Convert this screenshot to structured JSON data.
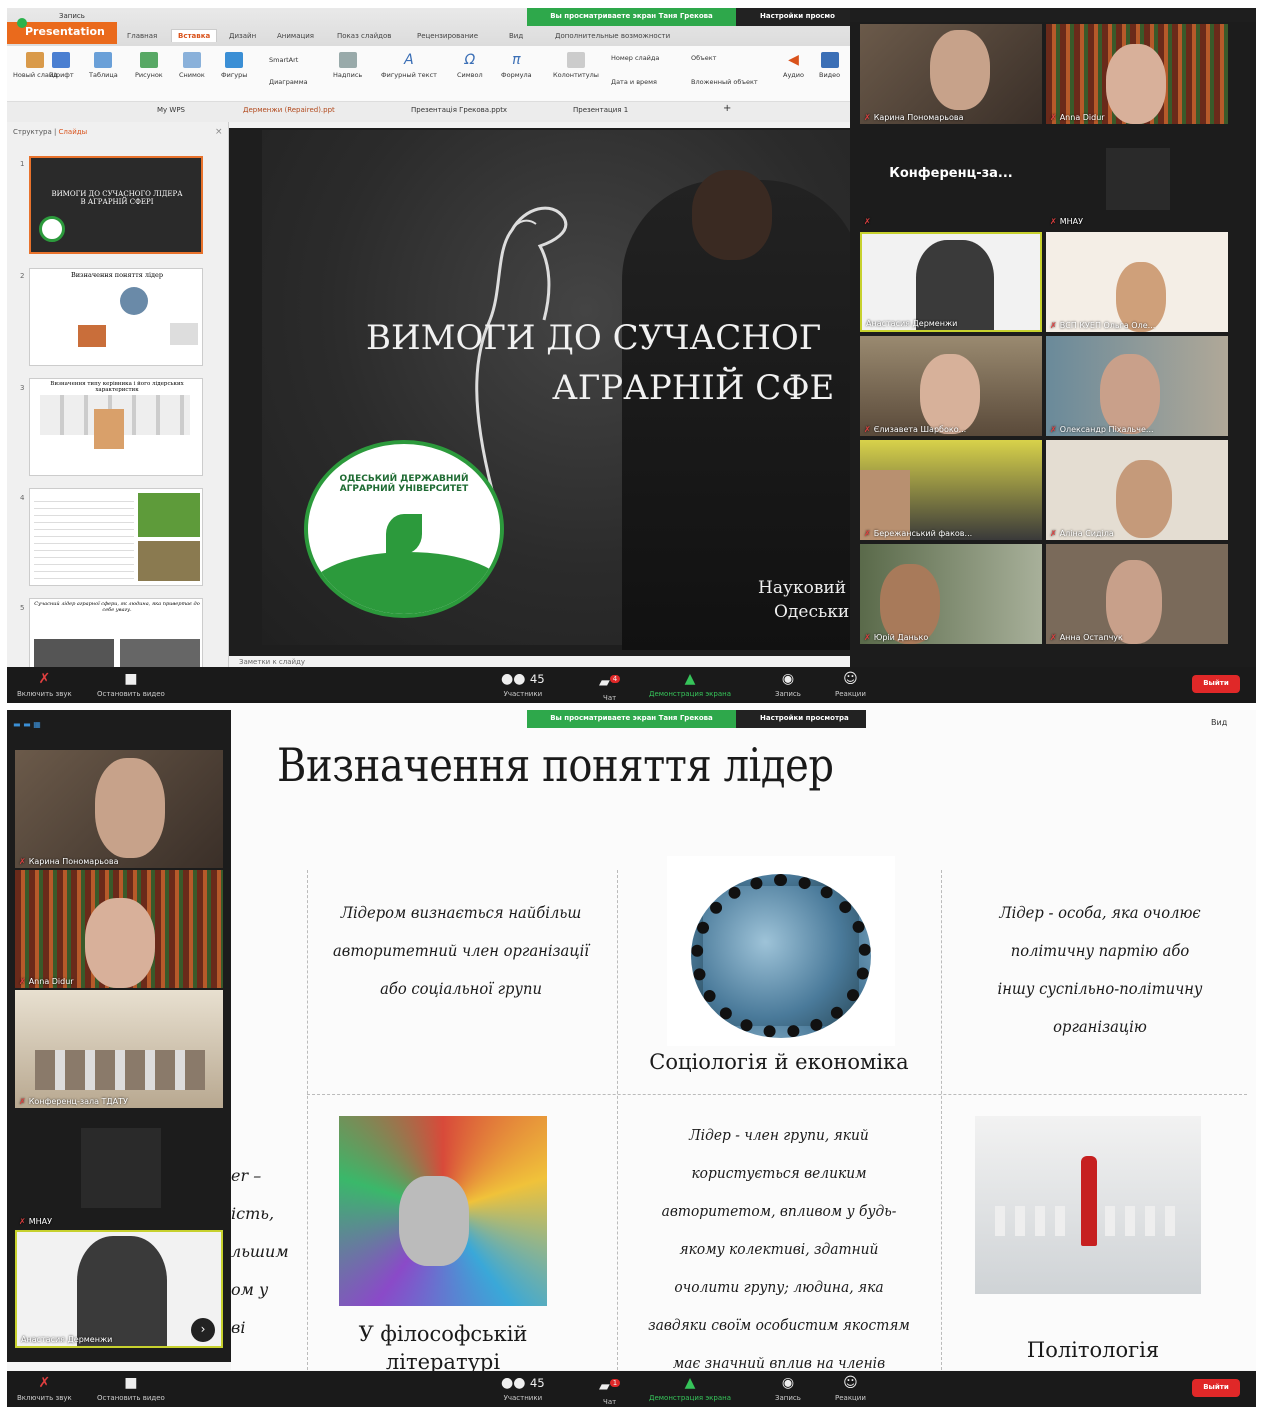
{
  "top": {
    "app_name": "Presentation",
    "record_label": "Запись",
    "menu_tabs": [
      "Главная",
      "Вставка",
      "Дизайн",
      "Анимация",
      "Показ слайдов",
      "Рецензирование",
      "Вид",
      "Дополнительные возможности"
    ],
    "ribbon": [
      "Новый слайд",
      "Шрифт",
      "Таблица",
      "Рисунок",
      "Снимок",
      "Фигуры",
      "Диаграмма",
      "Надпись",
      "Фигурный текст",
      "Символ",
      "Формула",
      "Колонтитулы",
      "Аудио",
      "Видео"
    ],
    "ribbon_small": [
      "SmartArt",
      "Номер слайда",
      "Объект",
      "Дата и время",
      "Вложенный объект"
    ],
    "doc_tabs": [
      "My WPS",
      "Дерменжи (Repaired).ppt",
      "Презентація Грекова.pptx",
      "Презентация 1"
    ],
    "pane_tabs": [
      "Структура",
      "Слайды"
    ],
    "thumbs": [
      {
        "num": "1",
        "text": "ВИМОГИ ДО СУЧАСНОГО ЛІДЕРА В АГРАРНІЙ СФЕРІ"
      },
      {
        "num": "2",
        "text": "Визначення поняття лідер"
      },
      {
        "num": "3",
        "text": "Визначення типу керівника і його лідерських характеристик"
      },
      {
        "num": "4",
        "text": ""
      },
      {
        "num": "5",
        "text": "Сучасний лідер аграрної сфери, як людина, яка привертає до себе увагу."
      }
    ],
    "slide_title_1": "ВИМОГИ ДО СУЧАСНОГ",
    "slide_title_2": "АГРАРНІЙ СФЕ",
    "logo_text": "ОДЕСЬКИЙ ДЕРЖАВНИЙ АГРАРНИЙ УНІВЕРСИТЕТ",
    "sci_1": "Науковий",
    "sci_2": "Одеськи",
    "notes": "Заметки к слайду",
    "share_banner": "Вы просматриваете экран Таня Грекова",
    "view_options": "Настройки просмо",
    "gallery_label": "Конференц-за...",
    "participants": [
      "Карина Пономарьова",
      "Anna Didur",
      "",
      "МНАУ",
      "Анастасия Дерменжи",
      "ВСП КУЕП Ольга Оле...",
      "Єлизавета Шарбоко...",
      "Олександр Піхальче...",
      "Бережанський факов...",
      "Аліна Сиділа",
      "Юрій Данько",
      "Анна Остапчук"
    ],
    "zoom_bar": {
      "mute": "Включить звук",
      "video": "Остановить видео",
      "participants": "Участники",
      "count": "45",
      "chat": "Чат",
      "chat_badge": "4",
      "share": "Демонстрация экрана",
      "record": "Запись",
      "reactions": "Реакции",
      "leave": "Выйти"
    }
  },
  "bottom": {
    "share_banner": "Вы просматриваете экран Таня Грекова",
    "view_options": "Настройки просмотра",
    "view_btn": "Вид",
    "participants": [
      "Карина Пономарьова",
      "Anna Didur",
      "Конференц-зала ТДАТУ",
      "МНАУ",
      "Анастасия Дерменжи"
    ],
    "slide_title": "Визначення поняття лідер",
    "def1": [
      "Лідером визнається найбільш",
      "авторитетний член організації",
      "або соціальної групи"
    ],
    "def2": [
      "Лідер - особа, яка очолює",
      "політичну партію або",
      "іншу суспільно-політичну",
      "організацію"
    ],
    "def3": [
      "Лідер - член групи, який",
      "користується великим",
      "авторитетом, впливом у будь-",
      "якому колективі, здатний",
      "очолити групу; людина, яка",
      "завдяки своїм особистим якостям",
      "має значний вплив на членів"
    ],
    "cap_soc": "Соціологія й економіка",
    "cap_phil_1": "У філософській",
    "cap_phil_2": "літературі",
    "cap_pol": "Політологія",
    "cut_text": [
      "er –",
      "ість,",
      "льшим",
      "ом у",
      "ві"
    ],
    "zoom_bar": {
      "mute": "Включить звук",
      "video": "Остановить видео",
      "participants": "Участники",
      "count": "45",
      "chat": "Чат",
      "chat_badge": "1",
      "share": "Демонстрация экрана",
      "record": "Запись",
      "reactions": "Реакции",
      "leave": "Выйти"
    }
  },
  "colors": {
    "accent": "#ea6a1c",
    "zoom_green": "#2ea84b",
    "leave_red": "#e02828",
    "highlight": "#c7d12e"
  }
}
